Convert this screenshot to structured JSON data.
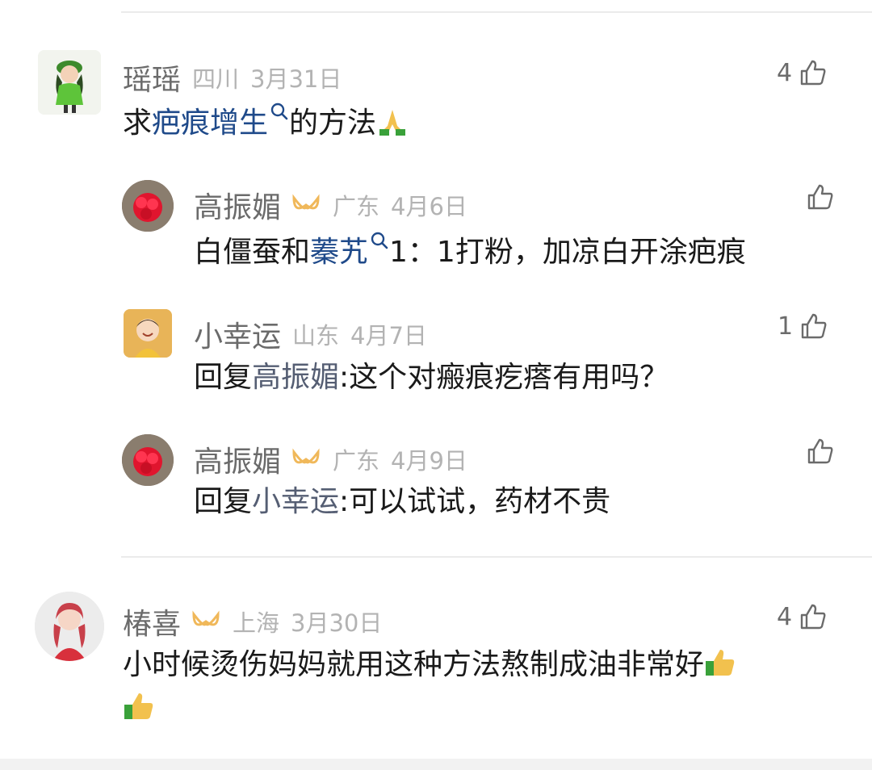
{
  "comments": [
    {
      "name": "瑶瑶",
      "location": "四川",
      "date": "3月31日",
      "likes": "4",
      "text_parts": [
        "求",
        "疤痕增生",
        "的方法"
      ],
      "emoji": "pray"
    },
    {
      "name": "高振媚",
      "badge": "vip-infinity",
      "location": "广东",
      "date": "4月6日",
      "likes": "",
      "text_parts": [
        "白僵蚕和",
        "蓁艽",
        "1：1打粉，加凉白开涂疤痕"
      ]
    },
    {
      "name": "小幸运",
      "location": "山东",
      "date": "4月7日",
      "likes": "1",
      "reply_prefix": "回复",
      "reply_to": "高振媚",
      "text": ":这个对瘢痕疙瘩有用吗？"
    },
    {
      "name": "高振媚",
      "badge": "vip-infinity",
      "location": "广东",
      "date": "4月9日",
      "likes": "",
      "reply_prefix": "回复",
      "reply_to": "小幸运",
      "text": ":可以试试，药材不贵"
    },
    {
      "name": "椿喜",
      "badge": "vip-infinity",
      "location": "上海",
      "date": "3月30日",
      "likes": "4",
      "text_line1": "小时候烫伤妈妈就用这种方法熬制成油非常好",
      "emoji": "thumbs-up"
    }
  ],
  "colors": {
    "name": "#6b6b6b",
    "meta": "#b3b3b3",
    "link": "#1f4a8a",
    "reply_name": "#555e73",
    "badge": "#f0b85a"
  }
}
